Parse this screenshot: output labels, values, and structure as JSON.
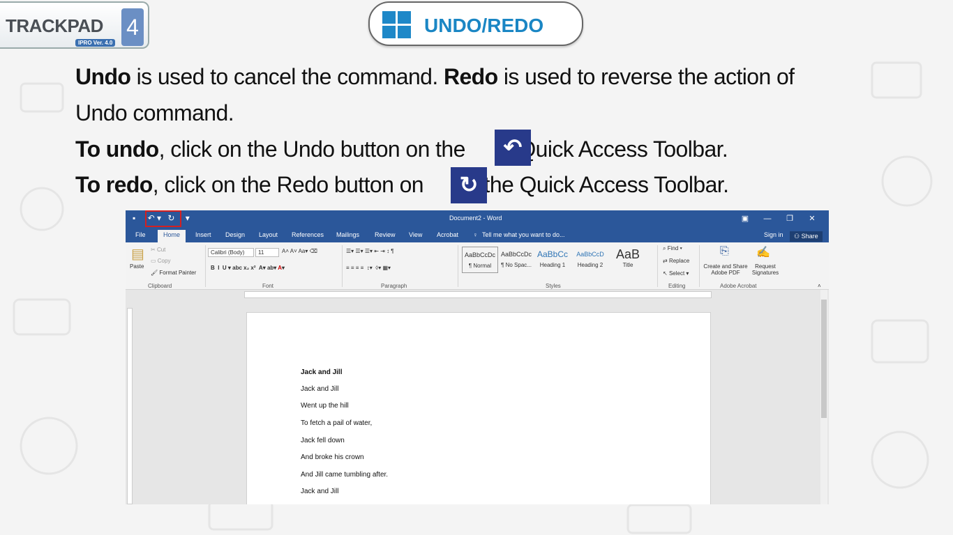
{
  "logo": {
    "text": "TRACKPAD",
    "sub": "IPRO Ver. 4.0",
    "number": "4"
  },
  "header": {
    "title": "UNDO/REDO",
    "icon": "windows-icon"
  },
  "lines": {
    "l1_bold1": "Undo",
    "l1_text1": " is used to cancel the command. ",
    "l1_bold2": "Redo",
    "l1_text2": " is used to reverse the action of",
    "l2_text": "Undo command.",
    "l3_bold": "To undo",
    "l3_text1": ", click on the Undo button on the ",
    "l3_text2": " Quick Access Toolbar.",
    "l4_bold": "To redo",
    "l4_text1": ", click on the Redo button on ",
    "l4_text2": " the Quick Access Toolbar."
  },
  "word": {
    "doc_title": "Document2 - Word",
    "tabs": [
      "File",
      "Home",
      "Insert",
      "Design",
      "Layout",
      "References",
      "Mailings",
      "Review",
      "View",
      "Acrobat"
    ],
    "tell_me": "Tell me what you want to do...",
    "sign_in": "Sign in",
    "share": "Share",
    "clipboard": {
      "paste": "Paste",
      "cut": "Cut",
      "copy": "Copy",
      "format_painter": "Format Painter",
      "label": "Clipboard"
    },
    "font": {
      "name": "Calibri (Body)",
      "size": "11",
      "label": "Font"
    },
    "paragraph_label": "Paragraph",
    "styles": [
      {
        "preview": "AaBbCcDc",
        "name": "¶ Normal"
      },
      {
        "preview": "AaBbCcDc",
        "name": "¶ No Spac..."
      },
      {
        "preview": "AaBbCc",
        "name": "Heading 1"
      },
      {
        "preview": "AaBbCcD",
        "name": "Heading 2"
      },
      {
        "preview": "AaB",
        "name": "Title"
      }
    ],
    "styles_label": "Styles",
    "editing": {
      "find": "Find",
      "replace": "Replace",
      "select": "Select",
      "label": "Editing"
    },
    "acrobat": {
      "create": "Create and Share",
      "create2": "Adobe PDF",
      "request": "Request",
      "request2": "Signatures",
      "label": "Adobe Acrobat"
    },
    "document_lines": [
      "Jack and Jill",
      "Jack and Jill",
      "Went up the hill",
      "To fetch a pail of water,",
      "Jack fell down",
      "And broke his crown",
      "And Jill came tumbling after.",
      "Jack and Jill"
    ]
  },
  "colors": {
    "word_blue": "#2b579a",
    "button_navy": "#283a8a",
    "title_blue": "#1a86c4",
    "highlight_red": "#d42020"
  }
}
